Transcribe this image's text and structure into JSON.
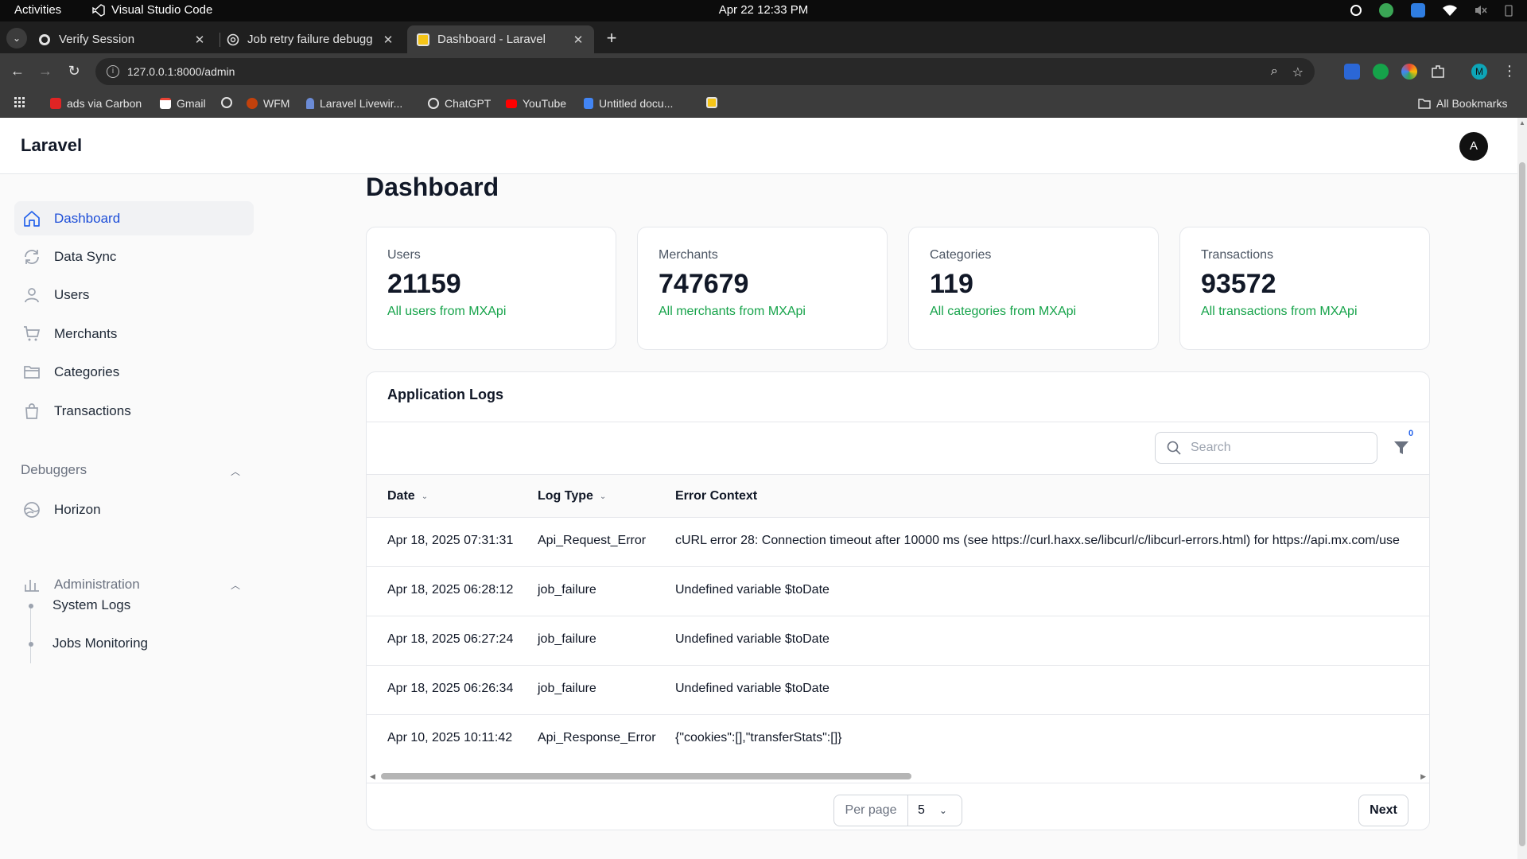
{
  "os_bar": {
    "activities": "Activities",
    "app_name": "Visual Studio Code",
    "datetime": "Apr 22  12:33 PM"
  },
  "browser": {
    "tabs": [
      {
        "title": "Verify Session",
        "icon": "github-icon"
      },
      {
        "title": "Job retry failure debugg",
        "icon": "chatgpt-icon"
      },
      {
        "title": "Dashboard - Laravel",
        "icon": "laravel-favicon",
        "active": true
      }
    ],
    "url": "127.0.0.1:8000/admin",
    "bookmarks": [
      {
        "label": "ads via Carbon",
        "icon": "carbon-icon"
      },
      {
        "label": "Gmail",
        "icon": "gmail-icon"
      },
      {
        "label": "",
        "icon": "globe-icon"
      },
      {
        "label": "WFM",
        "icon": "wfm-icon"
      },
      {
        "label": "Laravel Livewir...",
        "icon": "livewire-icon"
      },
      {
        "label": "ChatGPT",
        "icon": "chatgpt-icon"
      },
      {
        "label": "YouTube",
        "icon": "youtube-icon"
      },
      {
        "label": "Untitled docu...",
        "icon": "docs-icon"
      },
      {
        "label": "",
        "icon": "extension-bookmark-icon"
      }
    ],
    "all_bookmarks": "All Bookmarks",
    "profile_initial": "M"
  },
  "app": {
    "brand": "Laravel",
    "avatar_initial": "A",
    "nav": [
      {
        "label": "Dashboard",
        "icon": "home-icon",
        "active": true
      },
      {
        "label": "Data Sync",
        "icon": "sync-icon"
      },
      {
        "label": "Users",
        "icon": "user-icon"
      },
      {
        "label": "Merchants",
        "icon": "cart-icon"
      },
      {
        "label": "Categories",
        "icon": "folder-icon"
      },
      {
        "label": "Transactions",
        "icon": "bag-icon"
      }
    ],
    "debuggers": {
      "label": "Debuggers",
      "items": [
        {
          "label": "Horizon",
          "icon": "horizon-icon"
        }
      ]
    },
    "administration": {
      "label": "Administration",
      "items": [
        {
          "label": "System Logs"
        },
        {
          "label": "Jobs Monitoring"
        }
      ]
    },
    "page_title": "Dashboard",
    "stats": [
      {
        "label": "Users",
        "value": "21159",
        "desc": "All users from MXApi"
      },
      {
        "label": "Merchants",
        "value": "747679",
        "desc": "All merchants from MXApi"
      },
      {
        "label": "Categories",
        "value": "119",
        "desc": "All categories from MXApi"
      },
      {
        "label": "Transactions",
        "value": "93572",
        "desc": "All transactions from MXApi"
      }
    ],
    "logs": {
      "title": "Application Logs",
      "search_placeholder": "Search",
      "filter_count": "0",
      "columns": [
        "Date",
        "Log Type",
        "Error Context"
      ],
      "rows": [
        {
          "date": "Apr 18, 2025 07:31:31",
          "type": "Api_Request_Error",
          "context": "cURL error 28: Connection timeout after 10000 ms (see https://curl.haxx.se/libcurl/c/libcurl-errors.html) for https://api.mx.com/use"
        },
        {
          "date": "Apr 18, 2025 06:28:12",
          "type": "job_failure",
          "context": "Undefined variable $toDate"
        },
        {
          "date": "Apr 18, 2025 06:27:24",
          "type": "job_failure",
          "context": "Undefined variable $toDate"
        },
        {
          "date": "Apr 18, 2025 06:26:34",
          "type": "job_failure",
          "context": "Undefined variable $toDate"
        },
        {
          "date": "Apr 10, 2025 10:11:42",
          "type": "Api_Response_Error",
          "context": "{\"cookies\":[],\"transferStats\":[]}"
        }
      ],
      "per_page_label": "Per page",
      "per_page_value": "5",
      "next_label": "Next"
    }
  }
}
